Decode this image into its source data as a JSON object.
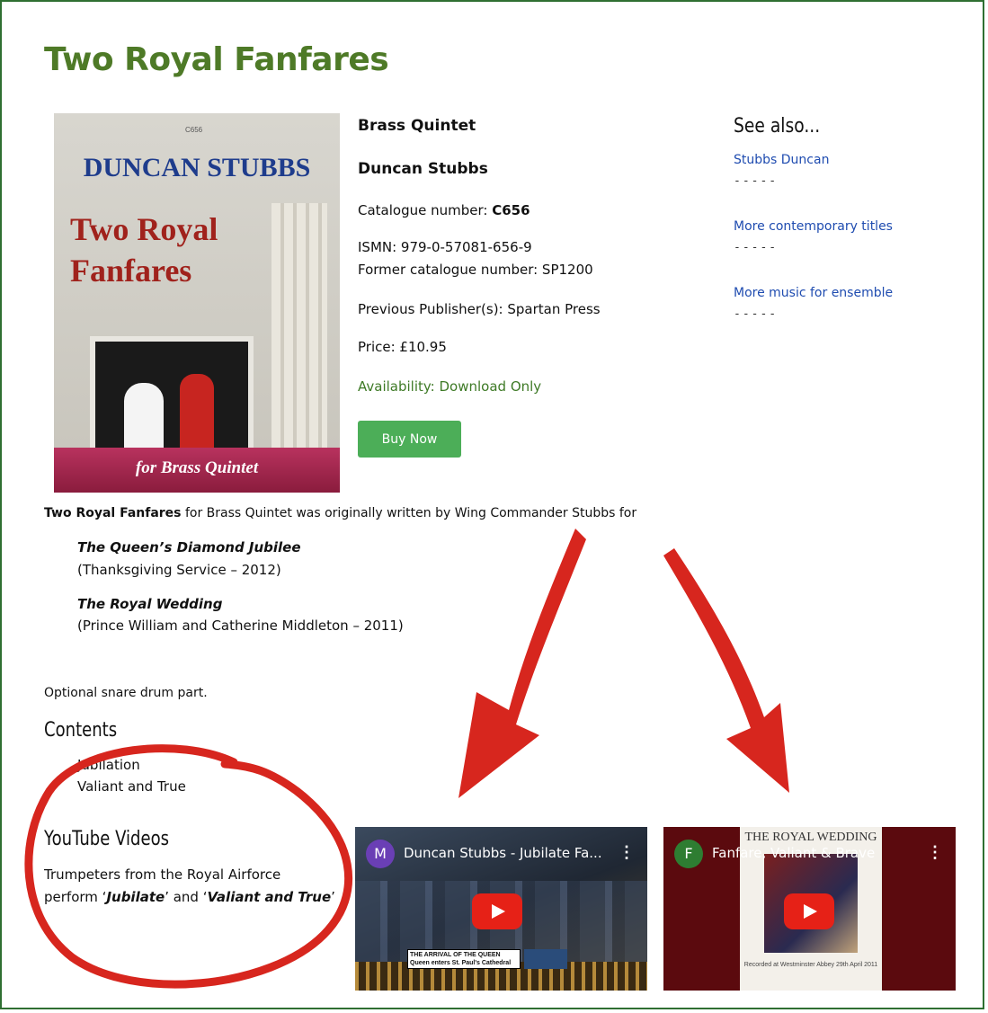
{
  "page": {
    "title": "Two Royal Fanfares"
  },
  "cover": {
    "code": "C656",
    "author": "DUNCAN STUBBS",
    "title_line1": "Two Royal",
    "title_line2": "Fanfares",
    "banner": "for Brass Quintet"
  },
  "details": {
    "instrumentation": "Brass Quintet",
    "composer": "Duncan Stubbs",
    "catalogue_label": "Catalogue number: ",
    "catalogue_value": "C656",
    "ismn": "ISMN: 979-0-57081-656-9",
    "former": "Former catalogue number: SP1200",
    "previous": "Previous Publisher(s): Spartan Press",
    "price": "Price: £10.95",
    "availability": "Availability: Download Only",
    "buy_label": "Buy Now"
  },
  "see_also": {
    "heading": "See also...",
    "dashes": "-----",
    "links": [
      "Stubbs Duncan",
      "More contemporary titles",
      "More music for ensemble"
    ]
  },
  "description": {
    "bold": "Two Royal Fanfares",
    "rest": " for Brass Quintet was originally written by Wing Commander Stubbs for",
    "occasions": [
      {
        "name": "The Queen’s Diamond Jubilee",
        "detail": "(Thanksgiving Service – 2012)"
      },
      {
        "name": "The Royal Wedding",
        "detail": "(Prince William and Catherine Middleton – 2011)"
      }
    ],
    "snare": "Optional snare drum part."
  },
  "contents": {
    "heading": "Contents",
    "items": [
      "Jubilation",
      "Valiant and True"
    ]
  },
  "youtube": {
    "heading": "YouTube Videos",
    "line1": "Trumpeters from the Royal Airforce",
    "line2_pre": "perform ‘",
    "piece1": "Jubilate",
    "line2_mid": "’ and ‘",
    "piece2": "Valiant and True",
    "line2_post": "’",
    "videos": [
      {
        "avatar": "M",
        "avatar_color": "#6a3fb5",
        "title": "Duncan Stubbs - Jubilate Fa...",
        "caption_line1": "THE ARRIVAL OF THE QUEEN",
        "caption_line2": "Queen enters St. Paul's Cathedral"
      },
      {
        "avatar": "F",
        "avatar_color": "#2e7d32",
        "title": "Fanfare, Valiant & Brave",
        "poster_title": "THE ROYAL WEDDING",
        "poster_caption": "Recorded at Westminster Abbey 29th April 2011"
      }
    ]
  },
  "colors": {
    "title": "#4e7a27",
    "link": "#1f4cb0",
    "buy": "#4cae58",
    "annotation": "#d7261e",
    "frame": "#2f6f32"
  }
}
